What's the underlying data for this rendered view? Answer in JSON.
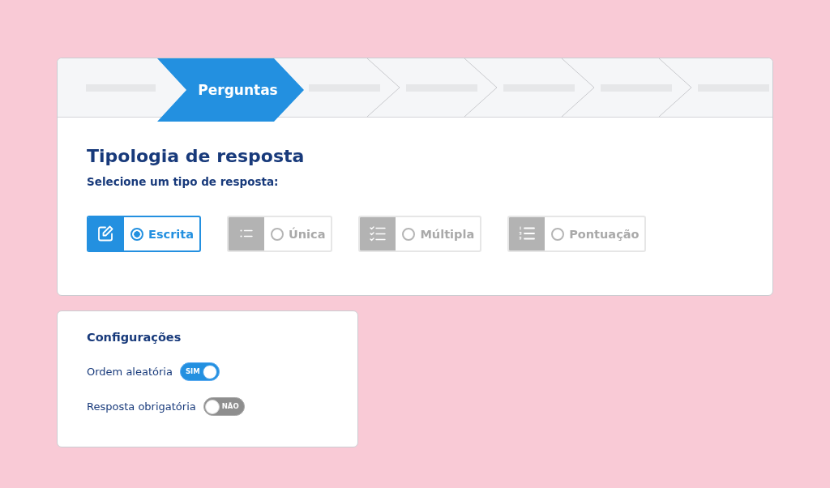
{
  "stepper": {
    "steps": [
      {
        "selected": false
      },
      {
        "label": "Perguntas",
        "selected": true
      },
      {
        "selected": false
      },
      {
        "selected": false
      },
      {
        "selected": false
      },
      {
        "selected": false
      },
      {
        "selected": false
      }
    ]
  },
  "answer_type": {
    "title": "Tipologia de resposta",
    "subtitle": "Selecione um tipo de resposta:",
    "options": [
      {
        "label": "Escrita",
        "selected": true
      },
      {
        "label": "Única",
        "selected": false
      },
      {
        "label": "Múltipla",
        "selected": false
      },
      {
        "label": "Pontuação",
        "selected": false
      }
    ]
  },
  "settings": {
    "title": "Configurações",
    "toggles": [
      {
        "label": "Ordem aleatória",
        "on": true,
        "state_text": "SIM"
      },
      {
        "label": "Resposta obrigatória",
        "on": false,
        "state_text": "NÃO"
      }
    ]
  }
}
